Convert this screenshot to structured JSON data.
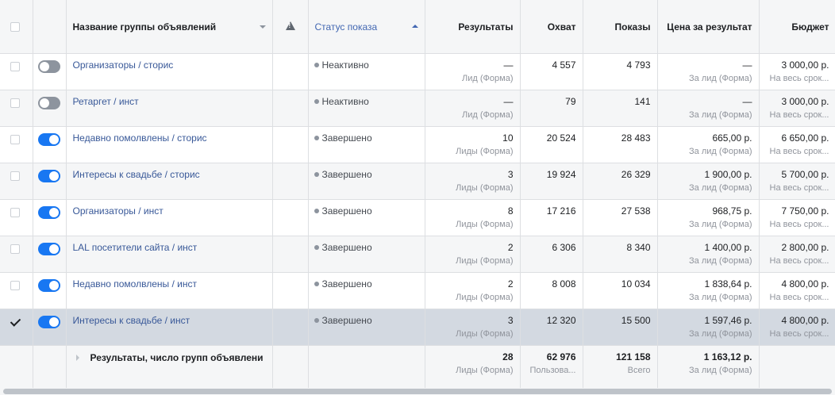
{
  "headers": {
    "name": "Название группы объявлений",
    "status": "Статус показа",
    "results": "Результаты",
    "reach": "Охват",
    "impressions": "Показы",
    "cost": "Цена за результат",
    "budget": "Бюджет"
  },
  "rows": [
    {
      "checked": false,
      "toggle": "off",
      "name": "Организаторы / сторис",
      "status": "Неактивно",
      "results": "—",
      "results_sub": "Лид (Форма)",
      "reach": "4 557",
      "impressions": "4 793",
      "cost": "—",
      "cost_sub": "За лид (Форма)",
      "budget": "3 000,00 р.",
      "budget_sub": "На весь срок..."
    },
    {
      "checked": false,
      "toggle": "off",
      "name": "Ретаргет / инст",
      "status": "Неактивно",
      "results": "—",
      "results_sub": "Лид (Форма)",
      "reach": "79",
      "impressions": "141",
      "cost": "—",
      "cost_sub": "За лид (Форма)",
      "budget": "3 000,00 р.",
      "budget_sub": "На весь срок..."
    },
    {
      "checked": false,
      "toggle": "on",
      "name": "Недавно помолвлены / сторис",
      "status": "Завершено",
      "results": "10",
      "results_sub": "Лиды (Форма)",
      "reach": "20 524",
      "impressions": "28 483",
      "cost": "665,00 р.",
      "cost_sub": "За лид (Форма)",
      "budget": "6 650,00 р.",
      "budget_sub": "На весь срок..."
    },
    {
      "checked": false,
      "toggle": "on",
      "name": "Интересы к свадьбе / сторис",
      "status": "Завершено",
      "results": "3",
      "results_sub": "Лиды (Форма)",
      "reach": "19 924",
      "impressions": "26 329",
      "cost": "1 900,00 р.",
      "cost_sub": "За лид (Форма)",
      "budget": "5 700,00 р.",
      "budget_sub": "На весь срок..."
    },
    {
      "checked": false,
      "toggle": "on",
      "name": "Организаторы / инст",
      "status": "Завершено",
      "results": "8",
      "results_sub": "Лиды (Форма)",
      "reach": "17 216",
      "impressions": "27 538",
      "cost": "968,75 р.",
      "cost_sub": "За лид (Форма)",
      "budget": "7 750,00 р.",
      "budget_sub": "На весь срок..."
    },
    {
      "checked": false,
      "toggle": "on",
      "name": "LAL посетители сайта / инст",
      "status": "Завершено",
      "results": "2",
      "results_sub": "Лиды (Форма)",
      "reach": "6 306",
      "impressions": "8 340",
      "cost": "1 400,00 р.",
      "cost_sub": "За лид (Форма)",
      "budget": "2 800,00 р.",
      "budget_sub": "На весь срок..."
    },
    {
      "checked": false,
      "toggle": "on",
      "name": "Недавно помолвлены / инст",
      "status": "Завершено",
      "results": "2",
      "results_sub": "Лиды (Форма)",
      "reach": "8 008",
      "impressions": "10 034",
      "cost": "1 838,64 р.",
      "cost_sub": "За лид (Форма)",
      "budget": "4 800,00 р.",
      "budget_sub": "На весь срок..."
    },
    {
      "checked": true,
      "toggle": "on",
      "name": "Интересы к свадьбе / инст",
      "status": "Завершено",
      "results": "3",
      "results_sub": "Лиды (Форма)",
      "reach": "12 320",
      "impressions": "15 500",
      "cost": "1 597,46 р.",
      "cost_sub": "За лид (Форма)",
      "budget": "4 800,00 р.",
      "budget_sub": "На весь срок..."
    }
  ],
  "totals": {
    "label": "Результаты, число групп объявлени",
    "results": "28",
    "results_sub": "Лиды (Форма)",
    "reach": "62 976",
    "reach_sub": "Пользова...",
    "impressions": "121 158",
    "impressions_sub": "Всего",
    "cost": "1 163,12 р.",
    "cost_sub": "За лид (Форма)"
  },
  "colors": {
    "accent": "#1877f2",
    "link": "#385898",
    "selected_row": "#d3d9e1"
  }
}
